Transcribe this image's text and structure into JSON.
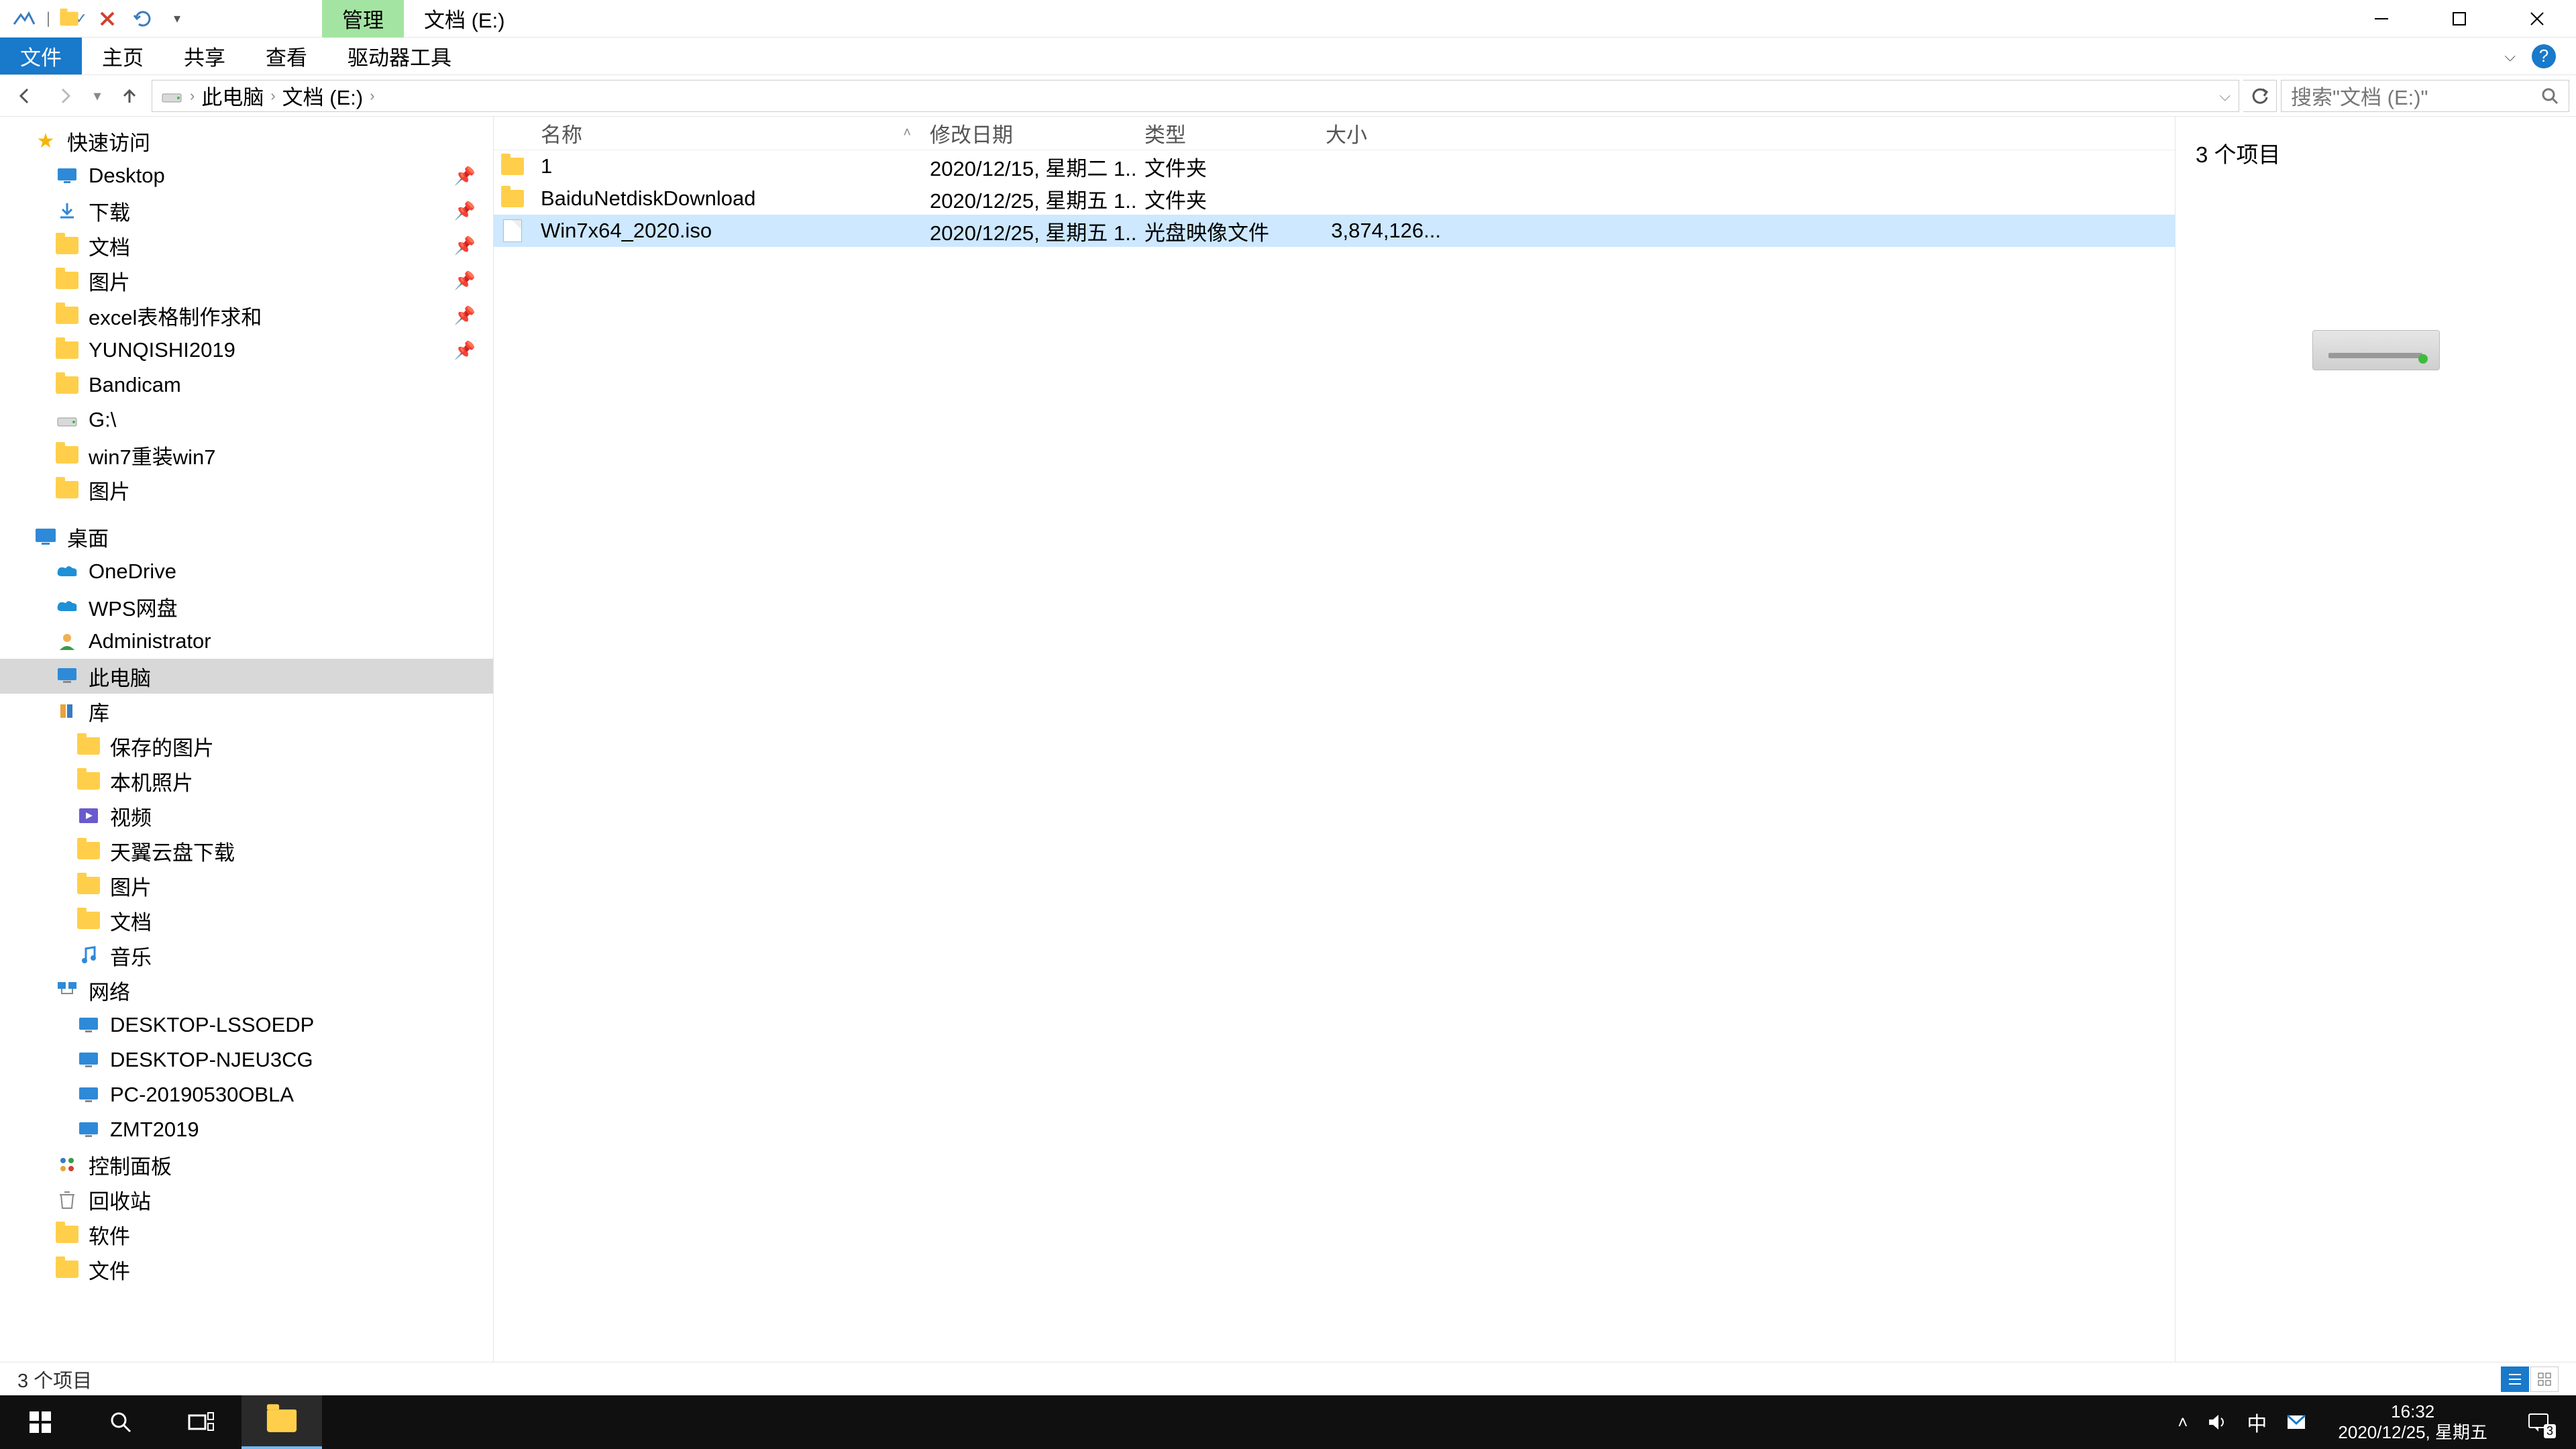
{
  "titlebar": {
    "management_tab": "管理",
    "location_tab": "文档 (E:)"
  },
  "ribbon": {
    "tabs": [
      "文件",
      "主页",
      "共享",
      "查看",
      "驱动器工具"
    ]
  },
  "address": {
    "crumbs": [
      "此电脑",
      "文档 (E:)"
    ],
    "search_placeholder": "搜索\"文档 (E:)\""
  },
  "tree": {
    "quick_access": "快速访问",
    "quick_items": [
      {
        "label": "Desktop",
        "pinned": true
      },
      {
        "label": "下载",
        "pinned": true
      },
      {
        "label": "文档",
        "pinned": true
      },
      {
        "label": "图片",
        "pinned": true
      },
      {
        "label": "excel表格制作求和",
        "pinned": true
      },
      {
        "label": "YUNQISHI2019",
        "pinned": true
      },
      {
        "label": "Bandicam",
        "pinned": false
      },
      {
        "label": "G:\\",
        "pinned": false
      },
      {
        "label": "win7重装win7",
        "pinned": false
      },
      {
        "label": "图片",
        "pinned": false
      }
    ],
    "desktop": "桌面",
    "desktop_items": [
      "OneDrive",
      "WPS网盘",
      "Administrator",
      "此电脑",
      "库",
      "保存的图片",
      "本机照片",
      "视频",
      "天翼云盘下载",
      "图片",
      "文档",
      "音乐",
      "网络",
      "DESKTOP-LSSOEDP",
      "DESKTOP-NJEU3CG",
      "PC-20190530OBLA",
      "ZMT2019",
      "控制面板",
      "回收站",
      "软件",
      "文件"
    ],
    "selected": "此电脑"
  },
  "list": {
    "columns": {
      "name": "名称",
      "date": "修改日期",
      "type": "类型",
      "size": "大小"
    },
    "rows": [
      {
        "name": "1",
        "date": "2020/12/15, 星期二 1...",
        "type": "文件夹",
        "size": "",
        "kind": "folder"
      },
      {
        "name": "BaiduNetdiskDownload",
        "date": "2020/12/25, 星期五 1...",
        "type": "文件夹",
        "size": "",
        "kind": "folder"
      },
      {
        "name": "Win7x64_2020.iso",
        "date": "2020/12/25, 星期五 1...",
        "type": "光盘映像文件",
        "size": "3,874,126...",
        "kind": "file",
        "selected": true
      }
    ]
  },
  "preview": {
    "title": "3 个项目"
  },
  "status": {
    "text": "3 个项目"
  },
  "taskbar": {
    "time": "16:32",
    "date": "2020/12/25, 星期五",
    "ime": "中",
    "notif_count": "3"
  }
}
